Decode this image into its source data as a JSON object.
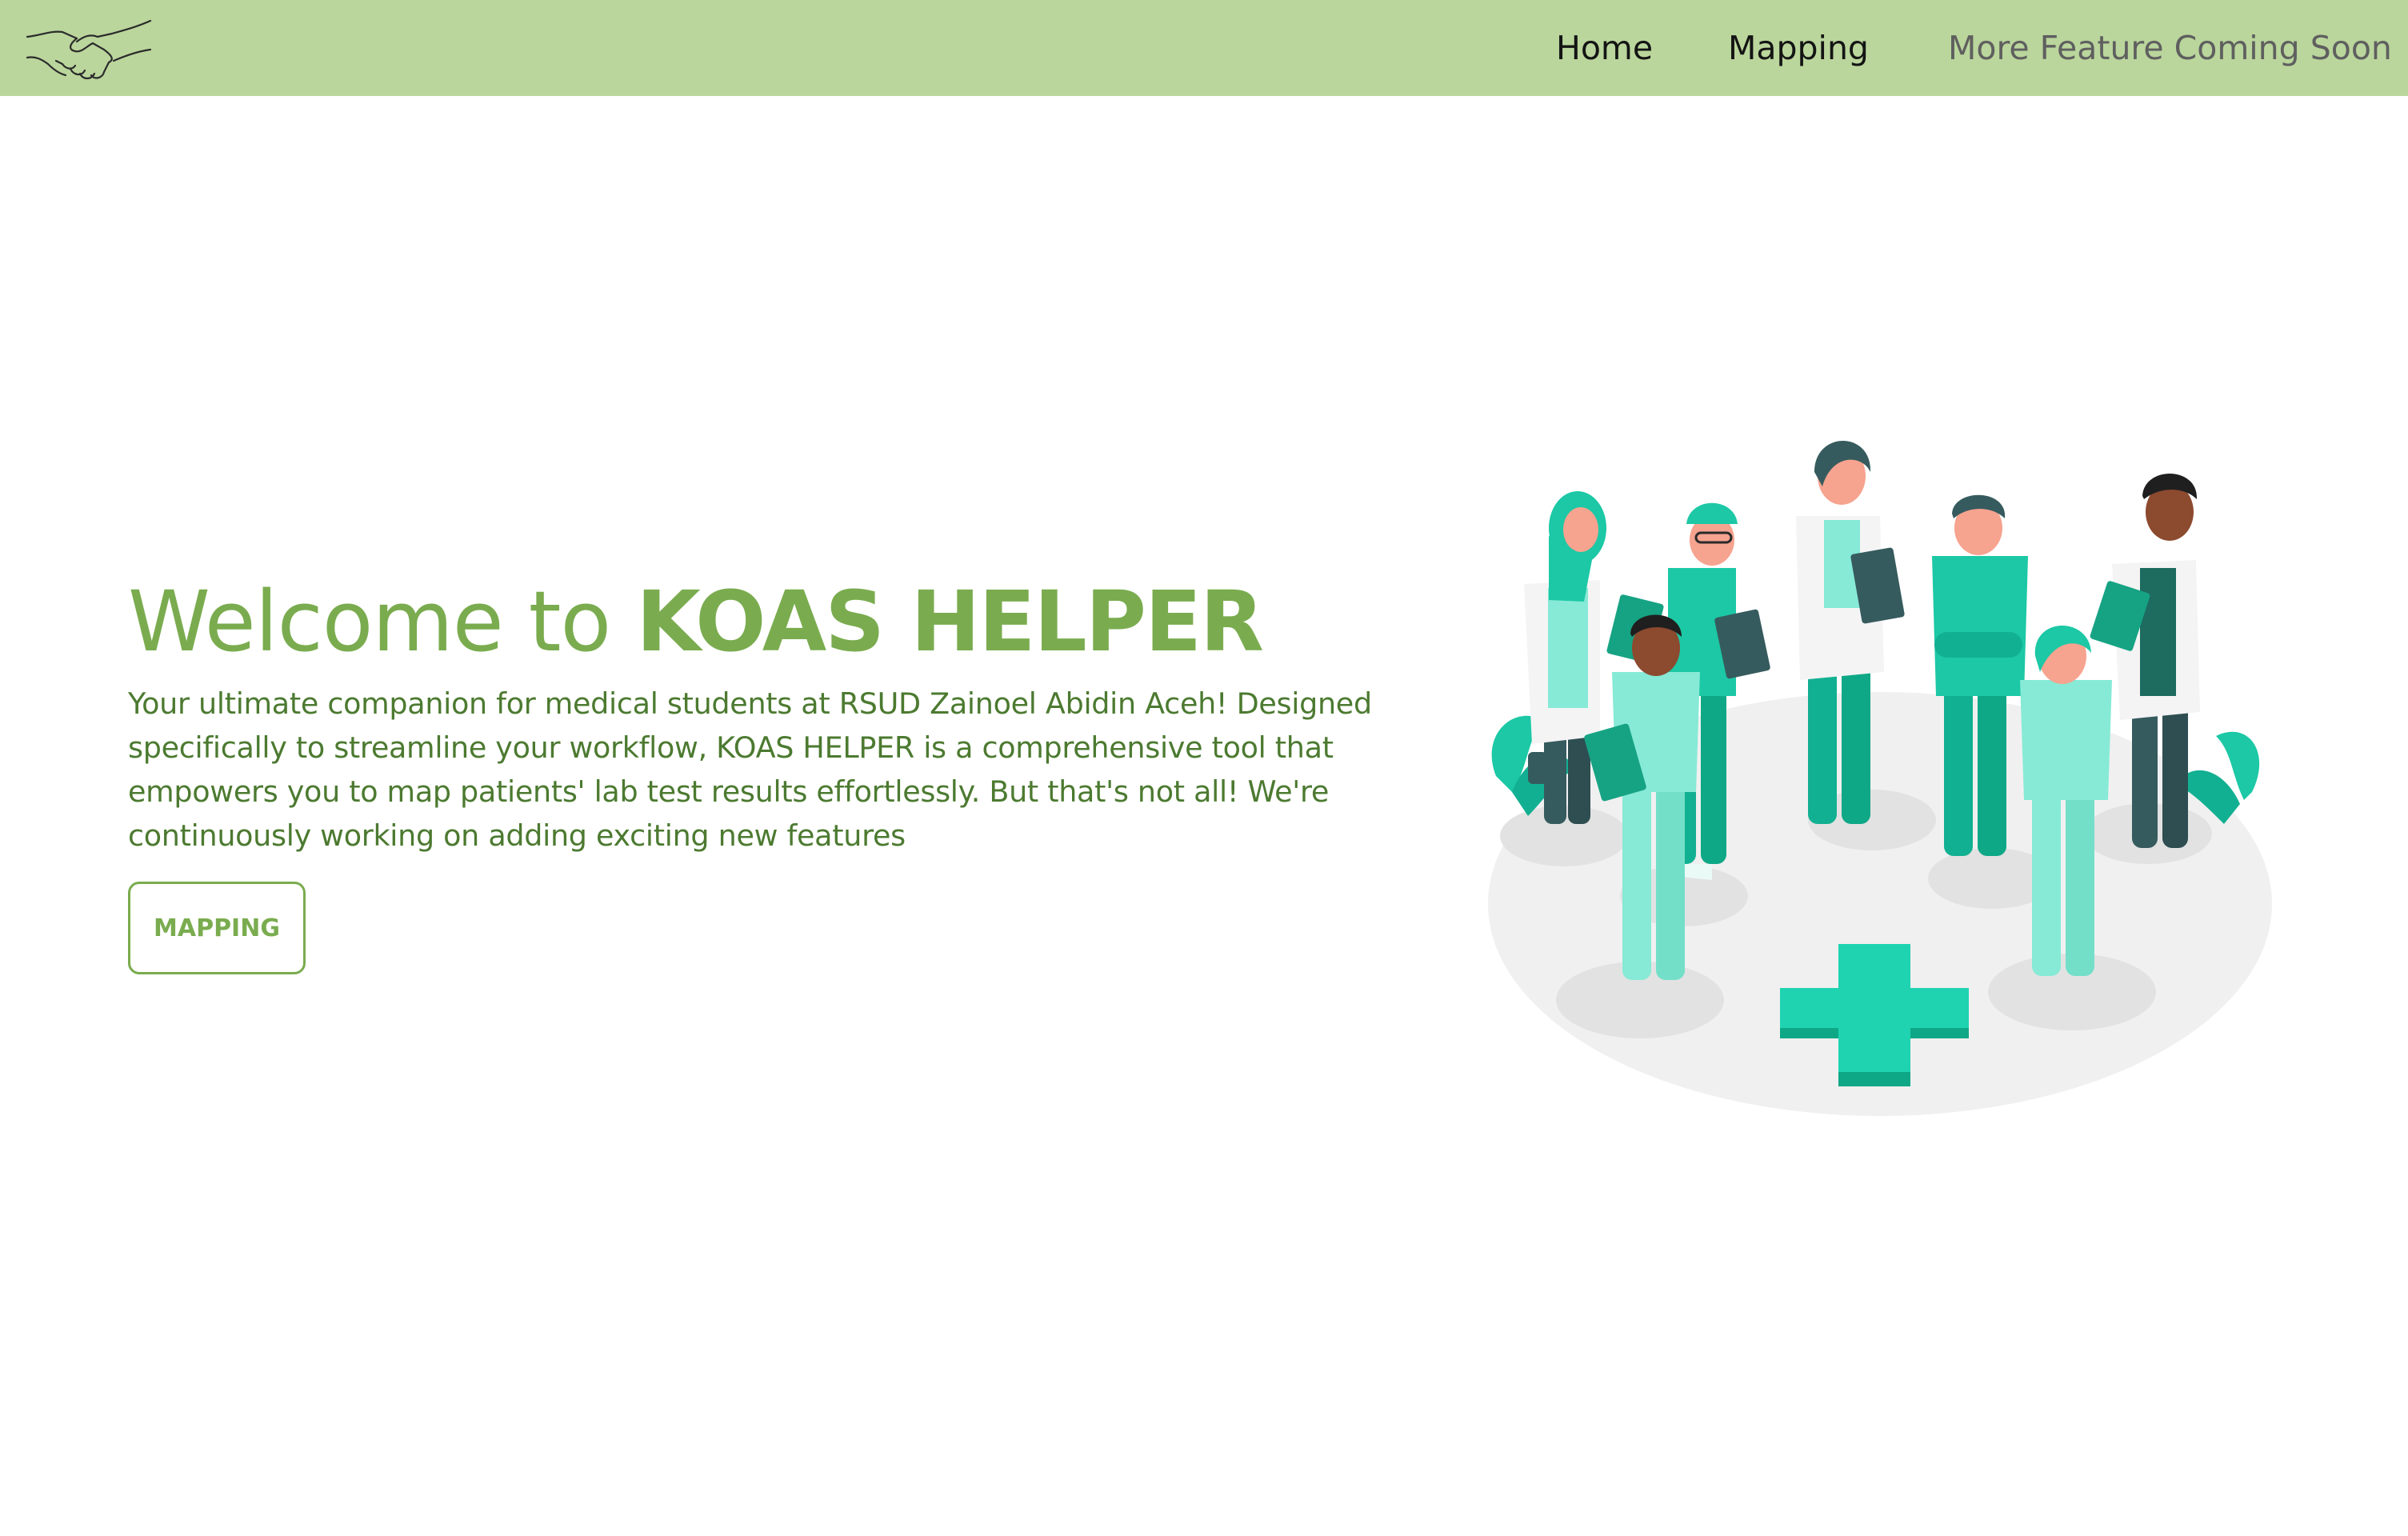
{
  "nav": {
    "logo_icon": "handshake-icon",
    "links": [
      "Home",
      "Mapping",
      "More Feature Coming Soon"
    ]
  },
  "hero": {
    "title_prefix": "Welcome to",
    "title_brand": "KOAS HELPER",
    "description": "Your ultimate companion for medical students at RSUD Zainoel Abidin Aceh! Designed specifically to streamline your workflow, KOAS HELPER is a comprehensive tool that empowers you to map patients' lab test results effortlessly. But that's not all! We're continuously working on adding exciting new features",
    "button_label": "MAPPING",
    "illustration": "medical-team-illustration"
  },
  "colors": {
    "navbar_bg": "#bad69c",
    "accent_green": "#7aac4f",
    "text_green": "#4c7a30",
    "teal": "#1cc8a5",
    "mint": "#86ead6"
  }
}
